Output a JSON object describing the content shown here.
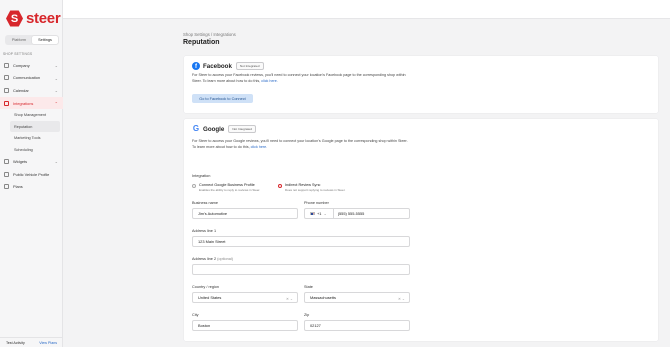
{
  "brand": {
    "name": "steer",
    "mark": "S"
  },
  "sidebar": {
    "toggle": {
      "platform": "Platform",
      "settings": "Settings"
    },
    "section_label": "SHOP SETTINGS",
    "items": [
      {
        "label": "Company"
      },
      {
        "label": "Communication"
      },
      {
        "label": "Calendar"
      },
      {
        "label": "Integrations"
      },
      {
        "label": "Widgets"
      },
      {
        "label": "Public Vehicle Profile"
      },
      {
        "label": "Plans"
      }
    ],
    "sub_items": [
      {
        "label": "Shop Management"
      },
      {
        "label": "Reputation"
      },
      {
        "label": "Marketing Tools"
      },
      {
        "label": "Scheduling"
      }
    ],
    "footer": {
      "left": "Test Activity",
      "right": "View Plans"
    }
  },
  "page": {
    "breadcrumb": "Shop Settings / Integrations",
    "title": "Reputation"
  },
  "facebook": {
    "title": "Facebook",
    "badge": "Not Integrated",
    "description": "For Steer to access your Facebook reviews, you'll need to connect your location's Facebook page to the corresponding shop within Steer. To learn more about how to do this,",
    "link": "click here.",
    "button": "Go to Facebook to Connect"
  },
  "google": {
    "title": "Google",
    "badge": "Not Integrated",
    "description": "For Steer to access your Google reviews, you'll need to connect your location's Google page to the corresponding shop within Steer. To learn more about how to do this,",
    "link": "click here.",
    "integration_label": "Integration",
    "options": [
      {
        "title": "Connect Google Business Profile",
        "sub": "Enables the ability to reply to reviews in Steer.",
        "selected": false
      },
      {
        "title": "Indirect Review Sync",
        "sub": "Does not support replying to reviews in Steer.",
        "selected": true
      }
    ],
    "form": {
      "business_name": {
        "label": "Business name",
        "value": "Jim's Automotive"
      },
      "phone": {
        "label": "Phone number",
        "code": "+1",
        "value": "(555) 555-5555"
      },
      "address1": {
        "label": "Address line 1",
        "value": "123 Main Street"
      },
      "address2": {
        "label": "Address line 2",
        "optional": "(optional)",
        "value": ""
      },
      "country": {
        "label": "Country / region",
        "value": "United States"
      },
      "state": {
        "label": "State",
        "value": "Massachusetts"
      },
      "city": {
        "label": "City",
        "value": "Boston"
      },
      "zip": {
        "label": "Zip",
        "value": "02127"
      }
    }
  },
  "colors": {
    "brand": "#d7262b",
    "link": "#2869c7",
    "button_bg": "#cfe1f7",
    "facebook": "#1877f2",
    "google": "#4285f4"
  }
}
